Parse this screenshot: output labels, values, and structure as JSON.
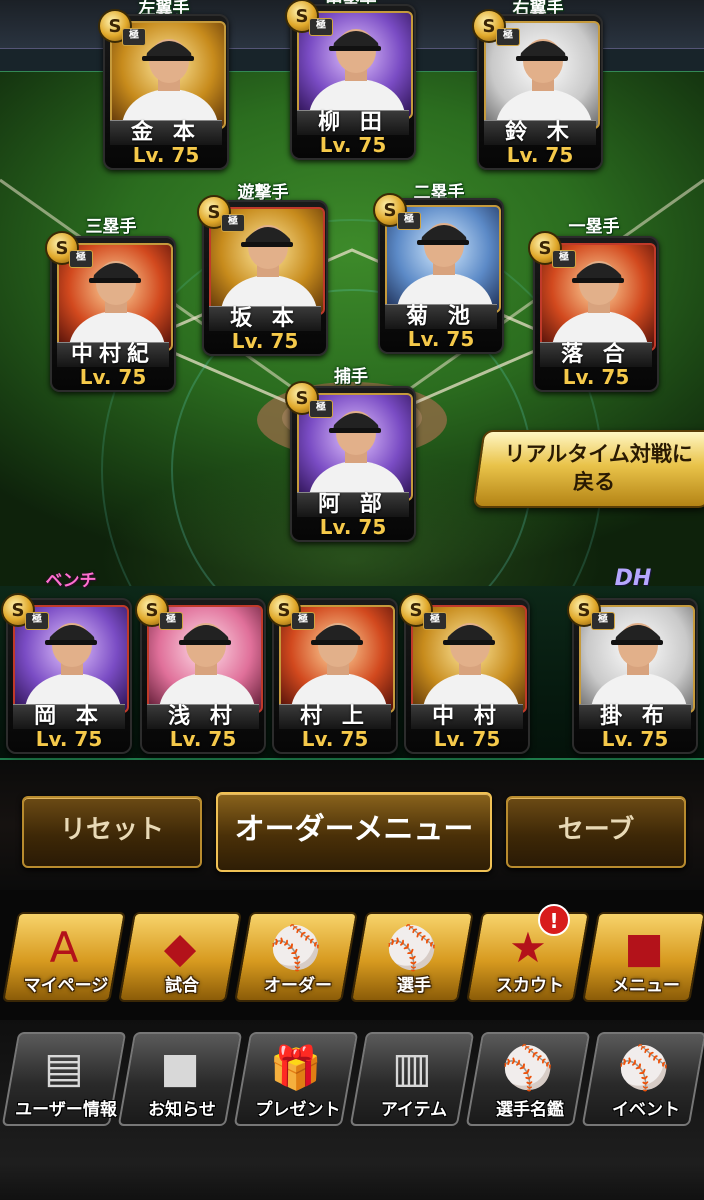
{
  "field": {
    "positions": [
      {
        "id": "lf",
        "pos_label": "左翼手",
        "name": "金 本",
        "level": "Lv. 75",
        "badge": "S",
        "rank": "極",
        "bg": "bg-gold",
        "frame": "gold"
      },
      {
        "id": "cf",
        "pos_label": "中堅手",
        "name": "柳 田",
        "level": "Lv. 75",
        "badge": "S",
        "rank": "極",
        "bg": "bg-purple",
        "frame": "gold"
      },
      {
        "id": "rf",
        "pos_label": "右翼手",
        "name": "鈴 木",
        "level": "Lv. 75",
        "badge": "S",
        "rank": "極",
        "bg": "bg-white",
        "frame": "gold"
      },
      {
        "id": "ss",
        "pos_label": "遊撃手",
        "name": "坂 本",
        "level": "Lv. 75",
        "badge": "S",
        "rank": "極",
        "bg": "bg-gold",
        "frame": "red"
      },
      {
        "id": "2b",
        "pos_label": "二塁手",
        "name": "菊 池",
        "level": "Lv. 75",
        "badge": "S",
        "rank": "極",
        "bg": "bg-blue",
        "frame": "gold"
      },
      {
        "id": "3b",
        "pos_label": "三塁手",
        "name": "中村紀",
        "level": "Lv. 75",
        "badge": "S",
        "rank": "極",
        "bg": "bg-fire",
        "frame": "gold"
      },
      {
        "id": "1b",
        "pos_label": "一塁手",
        "name": "落 合",
        "level": "Lv. 75",
        "badge": "S",
        "rank": "極",
        "bg": "bg-fire",
        "frame": "red"
      },
      {
        "id": "c",
        "pos_label": "捕手",
        "name": "阿 部",
        "level": "Lv. 75",
        "badge": "S",
        "rank": "極",
        "bg": "bg-purple",
        "frame": "gold"
      }
    ]
  },
  "bench": {
    "label": "ベンチ",
    "dh_label": "DH",
    "players": [
      {
        "id": "bench1",
        "name": "岡 本",
        "level": "Lv. 75",
        "badge": "S",
        "rank": "極",
        "bg": "bg-purple",
        "frame": "red"
      },
      {
        "id": "bench2",
        "name": "浅 村",
        "level": "Lv. 75",
        "badge": "S",
        "rank": "極",
        "bg": "bg-pink",
        "frame": "red"
      },
      {
        "id": "bench3",
        "name": "村 上",
        "level": "Lv. 75",
        "badge": "S",
        "rank": "極",
        "bg": "bg-fire",
        "frame": "gold"
      },
      {
        "id": "bench4",
        "name": "中 村",
        "level": "Lv. 75",
        "badge": "S",
        "rank": "極",
        "bg": "bg-gold",
        "frame": "red"
      },
      {
        "id": "dh",
        "name": "掛 布",
        "level": "Lv. 75",
        "badge": "S",
        "rank": "極",
        "bg": "bg-white",
        "frame": "gold"
      }
    ]
  },
  "realtime_button": {
    "line1": "リアルタイム対戦に",
    "line2": "戻る"
  },
  "order_bar": {
    "reset": "リセット",
    "menu": "オーダーメニュー",
    "save": "セーブ"
  },
  "nav_main": [
    {
      "label": "マイページ",
      "icon": "A"
    },
    {
      "label": "試合",
      "icon": "◆"
    },
    {
      "label": "オーダー",
      "icon": "⚾"
    },
    {
      "label": "選手",
      "icon": "⚾"
    },
    {
      "label": "スカウト",
      "icon": "★"
    },
    {
      "label": "メニュー",
      "icon": "■"
    }
  ],
  "nav_alert": "!",
  "nav_sub": [
    {
      "label": "ユーザー情報",
      "icon": "▤"
    },
    {
      "label": "お知らせ",
      "icon": "■"
    },
    {
      "label": "プレゼント",
      "icon": "🎁"
    },
    {
      "label": "アイテム",
      "icon": "▥"
    },
    {
      "label": "選手名鑑",
      "icon": "⚾"
    },
    {
      "label": "イベント",
      "icon": "⚾"
    }
  ],
  "colors": {
    "gold": "#f5c94a",
    "accent_button": "#e9c34a",
    "alert": "#d81c1c"
  }
}
